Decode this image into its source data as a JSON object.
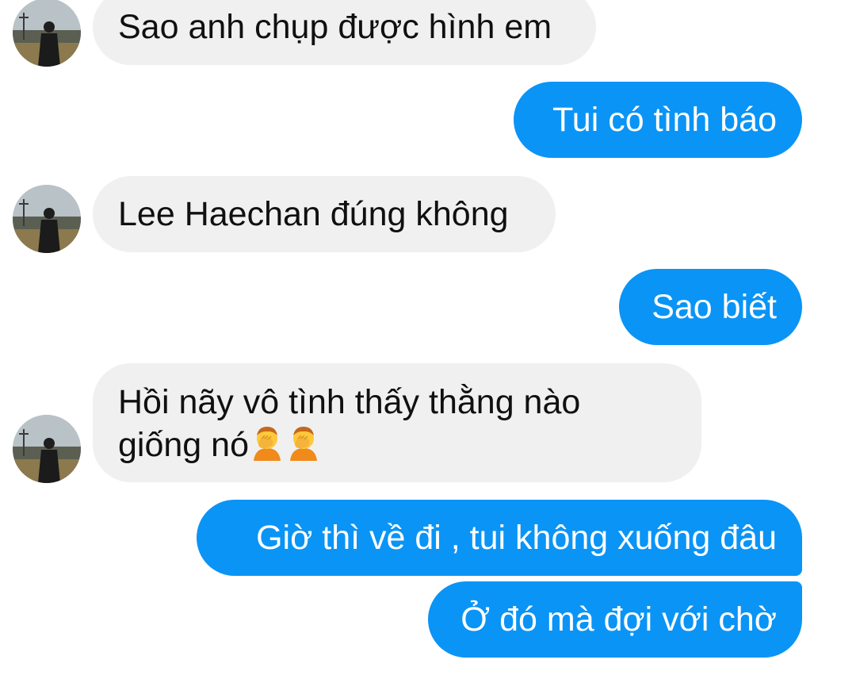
{
  "conversation": {
    "messages": [
      {
        "sender": "other",
        "text": "Sao anh chụp được hình em"
      },
      {
        "sender": "me",
        "text": "Tui có tình báo"
      },
      {
        "sender": "other",
        "text": "Lee Haechan đúng không"
      },
      {
        "sender": "me",
        "text": "Sao biết"
      },
      {
        "sender": "other",
        "lines": [
          "Hồi nãy vô tình thấy thằng nào",
          "giống nó"
        ],
        "emojis": [
          "person-facepalming-emoji",
          "person-facepalming-emoji"
        ]
      },
      {
        "sender": "me",
        "text": "Giờ thì về đi ,  tui không xuống đâu"
      },
      {
        "sender": "me",
        "text": "Ở đó mà đợi với chờ"
      }
    ]
  },
  "colors": {
    "incoming_bubble": "#f0f0f0",
    "outgoing_bubble": "#0a94f6",
    "incoming_text": "#101010",
    "outgoing_text": "#ffffff",
    "background": "#ffffff"
  }
}
